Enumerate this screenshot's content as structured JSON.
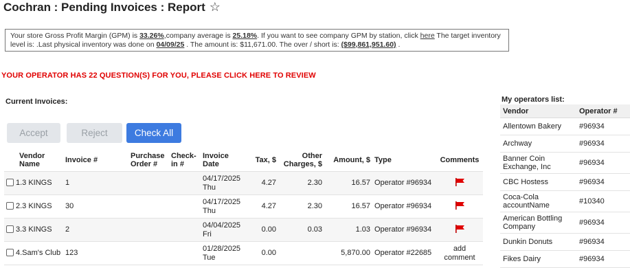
{
  "header": {
    "title": "Cochran : Pending Invoices : Report",
    "favorite_icon": "star-outline-icon"
  },
  "gpm": {
    "t1": "Your store Gross Profit Margin (GPM) is ",
    "store_gpm": "33.26%",
    "t2": ",company average is ",
    "company_avg": "25.18%",
    "t3": ". If you want to see company GPM by station, click ",
    "here_link": "here",
    "t4": " The target inventory level is: .Last physical inventory was done on ",
    "inventory_date": "04/09/25",
    "t5": " . The amount is: $11,671.00. The over / short is: ",
    "over_short": "($99,861,951.60)",
    "t6": " ."
  },
  "alert": {
    "text": "YOUR OPERATOR HAS 22 QUESTION(S) FOR YOU, PLEASE CLICK HERE TO REVIEW",
    "color": "#e00000"
  },
  "invoices": {
    "label": "Current Invoices:",
    "buttons": {
      "accept": "Accept",
      "reject": "Reject",
      "check_all": "Check All"
    },
    "headers": {
      "vendor": "Vendor Name",
      "invoice": "Invoice #",
      "po": "Purchase Order #",
      "checkin": "Check-in #",
      "date": "Invoice Date",
      "tax": "Tax, $",
      "other": "Other Charges, $",
      "amount": "Amount, $",
      "type": "Type",
      "comments": "Comments"
    },
    "rows": [
      {
        "vendor": "1.3 KINGS",
        "invoice": "1",
        "po": "",
        "checkin": "",
        "date": "04/17/2025",
        "day": "Thu",
        "tax": "4.27",
        "other": "2.30",
        "amount": "16.57",
        "type": "Operator #96934"
      },
      {
        "vendor": "2.3 KINGS",
        "invoice": "30",
        "po": "",
        "checkin": "",
        "date": "04/17/2025",
        "day": "Thu",
        "tax": "4.27",
        "other": "2.30",
        "amount": "16.57",
        "type": "Operator #96934"
      },
      {
        "vendor": "3.3 KINGS",
        "invoice": "2",
        "po": "",
        "checkin": "",
        "date": "04/04/2025",
        "day": "Fri",
        "tax": "0.00",
        "other": "0.03",
        "amount": "1.03",
        "type": "Operator #96934"
      },
      {
        "vendor": "4.Sam's Club",
        "invoice": "123",
        "po": "",
        "checkin": "",
        "date": "01/28/2025",
        "day": "Tue",
        "tax": "0.00",
        "other": "",
        "amount": "5,870.00",
        "type": "Operator #22685",
        "comment": "add comment"
      }
    ]
  },
  "operators": {
    "title": "My operators list:",
    "headers": {
      "vendor": "Vendor",
      "operator": "Operator #"
    },
    "rows": [
      {
        "vendor": "Allentown Bakery",
        "operator": "#96934"
      },
      {
        "vendor": "Archway",
        "operator": "#96934"
      },
      {
        "vendor": "Banner Coin Exchange, Inc",
        "operator": "#96934"
      },
      {
        "vendor": "CBC Hostess",
        "operator": "#96934"
      },
      {
        "vendor": "Coca-Cola accountName",
        "operator": "#10340"
      },
      {
        "vendor": "American Bottling Company",
        "operator": "#96934"
      },
      {
        "vendor": "Dunkin Donuts",
        "operator": "#96934"
      },
      {
        "vendor": "Fikes Dairy",
        "operator": "#96934"
      }
    ]
  },
  "colors": {
    "primary_button": "#3d7be0",
    "disabled_button": "#e3e6ea",
    "flag": "#e00000",
    "alert": "#e00000"
  }
}
